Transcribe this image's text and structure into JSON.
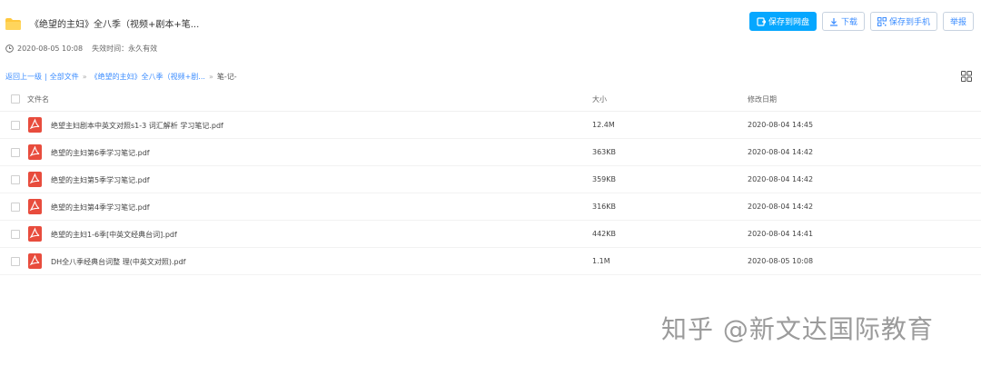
{
  "share": {
    "title": "《绝望的主妇》全八季（视频+剧本+笔...",
    "created": "2020-08-05 10:08",
    "expire_label": "失效时间：",
    "expire_value": "永久有效"
  },
  "actions": {
    "save_to_disk": "保存到网盘",
    "download": "下载",
    "save_to_phone": "保存到手机",
    "report": "举报"
  },
  "breadcrumb": {
    "back": "返回上一级",
    "all_files": "全部文件",
    "folder": "《绝望的主妇》全八季（视频+剧...",
    "current": "笔-记-"
  },
  "table": {
    "headers": {
      "name": "文件名",
      "size": "大小",
      "date": "修改日期"
    },
    "rows": [
      {
        "name": "绝望主妇剧本中英文对照s1-3 词汇解析 学习笔记.pdf",
        "size": "12.4M",
        "date": "2020-08-04 14:45",
        "icon": "pdf-icon"
      },
      {
        "name": "绝望的主妇第6季学习笔记.pdf",
        "size": "363KB",
        "date": "2020-08-04 14:42",
        "icon": "pdf-icon"
      },
      {
        "name": "绝望的主妇第5季学习笔记.pdf",
        "size": "359KB",
        "date": "2020-08-04 14:42",
        "icon": "pdf-icon"
      },
      {
        "name": "绝望的主妇第4季学习笔记.pdf",
        "size": "316KB",
        "date": "2020-08-04 14:42",
        "icon": "pdf-icon"
      },
      {
        "name": "绝望的主妇1-6季[中英文经典台词].pdf",
        "size": "442KB",
        "date": "2020-08-04 14:41",
        "icon": "pdf-icon"
      },
      {
        "name": "DH全八季经典台词整 理(中英文对照).pdf",
        "size": "1.1M",
        "date": "2020-08-05 10:08",
        "icon": "pdf-icon"
      }
    ]
  },
  "watermark": "知乎 @新文达国际教育",
  "colors": {
    "accent": "#06a7ff",
    "link": "#3b8cff",
    "pdf": "#e84c3d",
    "folder": "#ffc83d"
  }
}
